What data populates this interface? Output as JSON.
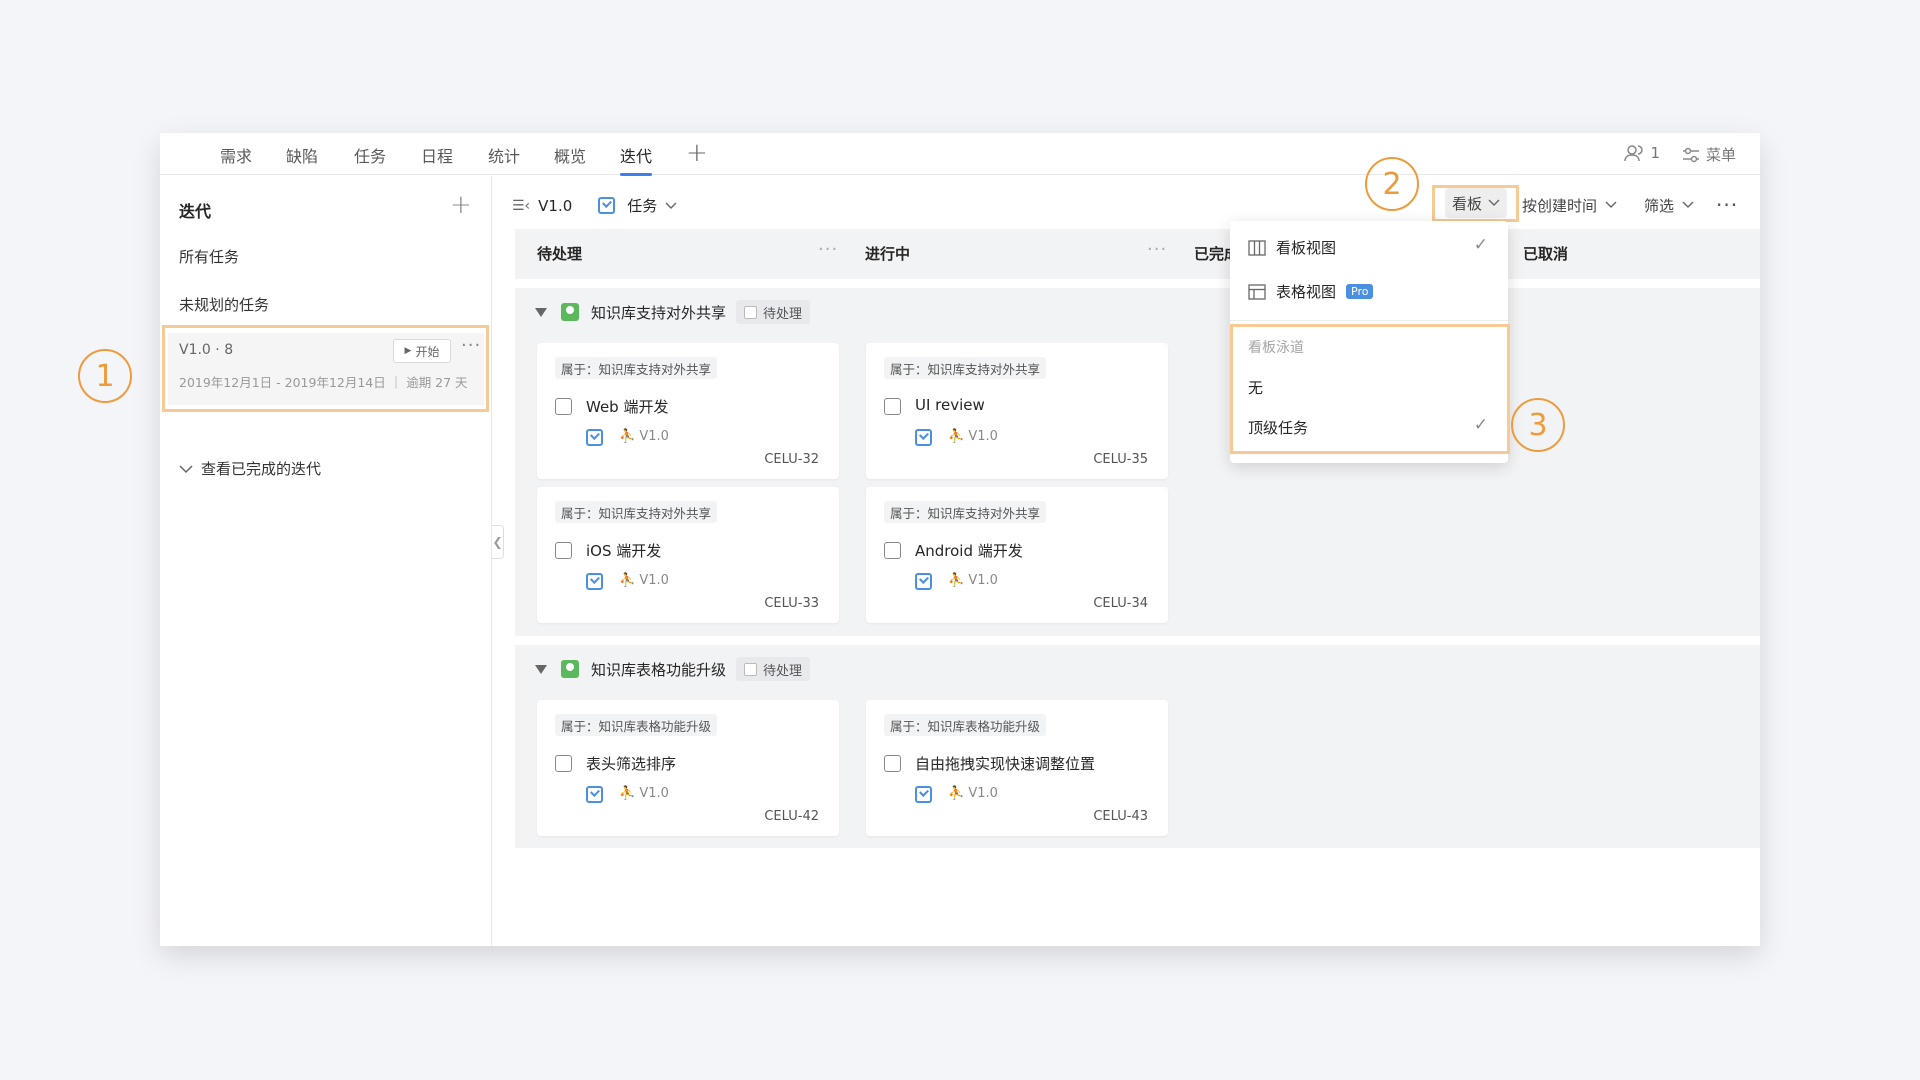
{
  "nav": {
    "tabs": [
      "需求",
      "缺陷",
      "任务",
      "日程",
      "统计",
      "概览",
      "迭代"
    ],
    "active_tab": "迭代",
    "members_count": "1",
    "menu_label": "菜单"
  },
  "sidebar": {
    "title": "迭代",
    "items": [
      "所有任务",
      "未规划的任务"
    ],
    "iteration": {
      "name": "V1.0",
      "count": "· 8",
      "start_label": "开始",
      "dates": "2019年12月1日 - 2019年12月14日 ｜ 逾期 27 天"
    },
    "completed_link": "查看已完成的迭代"
  },
  "toolbar": {
    "iteration": "V1.0",
    "type_label": "任务",
    "view_label": "看板",
    "sort_label": "按创建时间",
    "filter_label": "筛选"
  },
  "columns": [
    "待处理",
    "进行中",
    "已完成",
    "已取消"
  ],
  "lanes": [
    {
      "title": "知识库支持对外共享",
      "status": "待处理",
      "cards": [
        {
          "belong": "属于：知识库支持对外共享",
          "title": "Web 端开发",
          "version": "V1.0",
          "id": "CELU-32"
        },
        {
          "belong": "属于：知识库支持对外共享",
          "title": "UI review",
          "version": "V1.0",
          "id": "CELU-35"
        },
        {
          "belong": "属于：知识库支持对外共享",
          "title": "iOS 端开发",
          "version": "V1.0",
          "id": "CELU-33"
        },
        {
          "belong": "属于：知识库支持对外共享",
          "title": "Android 端开发",
          "version": "V1.0",
          "id": "CELU-34"
        }
      ]
    },
    {
      "title": "知识库表格功能升级",
      "status": "待处理",
      "cards": [
        {
          "belong": "属于：知识库表格功能升级",
          "title": "表头筛选排序",
          "version": "V1.0",
          "id": "CELU-42"
        },
        {
          "belong": "属于：知识库表格功能升级",
          "title": "自由拖拽实现快速调整位置",
          "version": "V1.0",
          "id": "CELU-43"
        }
      ]
    }
  ],
  "dropdown": {
    "views": [
      {
        "label": "看板视图",
        "checked": true
      },
      {
        "label": "表格视图",
        "badge": "Pro"
      }
    ],
    "swimlane_group": "看板泳道",
    "swimlane_options": [
      {
        "label": "无"
      },
      {
        "label": "顶级任务",
        "checked": true
      }
    ]
  },
  "annotations": [
    "1",
    "2",
    "3"
  ],
  "colors": {
    "accent": "#3d7ef0",
    "annotation": "#ee9b3c",
    "highlight": "#f6c995"
  }
}
